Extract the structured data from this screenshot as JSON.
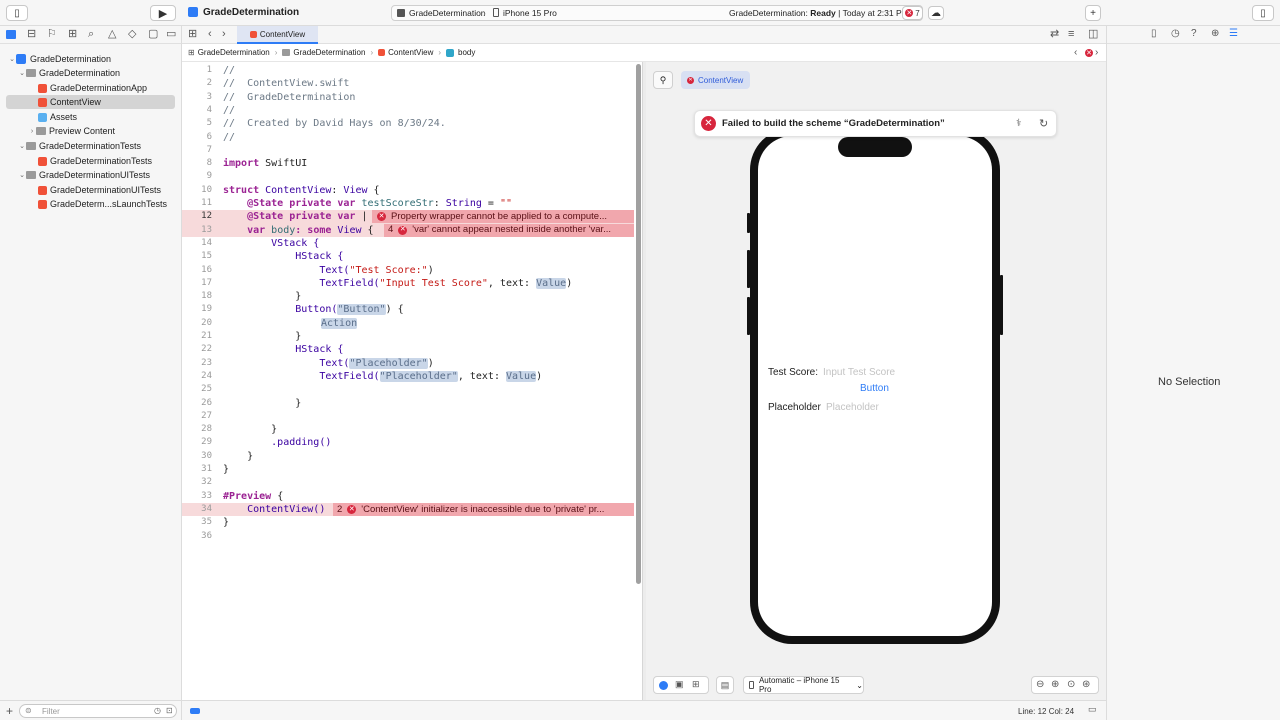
{
  "toolbar": {
    "project_name": "GradeDetermination",
    "scheme": "GradeDetermination",
    "device": "iPhone 15 Pro",
    "status_prefix": "GradeDetermination: ",
    "status_state": "Ready",
    "status_time": "| Today at 2:31 PM",
    "error_count": "7"
  },
  "tab": {
    "label": "ContentView"
  },
  "jumpbar": [
    "GradeDetermination",
    "GradeDetermination",
    "ContentView",
    "body"
  ],
  "navigator": {
    "items": [
      {
        "label": "GradeDetermination",
        "kind": "project"
      },
      {
        "label": "GradeDetermination",
        "kind": "folder"
      },
      {
        "label": "GradeDeterminationApp",
        "kind": "swift"
      },
      {
        "label": "ContentView",
        "kind": "swift"
      },
      {
        "label": "Assets",
        "kind": "asset"
      },
      {
        "label": "Preview Content",
        "kind": "folder"
      },
      {
        "label": "GradeDeterminationTests",
        "kind": "folder"
      },
      {
        "label": "GradeDeterminationTests",
        "kind": "swift"
      },
      {
        "label": "GradeDeterminationUITests",
        "kind": "folder"
      },
      {
        "label": "GradeDeterminationUITests",
        "kind": "swift"
      },
      {
        "label": "GradeDeterm...sLaunchTests",
        "kind": "swift"
      }
    ],
    "filter_placeholder": "Filter"
  },
  "code": {
    "line_numbers": [
      "1",
      "2",
      "3",
      "4",
      "5",
      "6",
      "7",
      "8",
      "9",
      "10",
      "11",
      "12",
      "13",
      "14",
      "15",
      "16",
      "17",
      "18",
      "19",
      "20",
      "21",
      "22",
      "23",
      "24",
      "25",
      "26",
      "27",
      "28",
      "29",
      "30",
      "31",
      "32",
      "33",
      "34",
      "35",
      "36"
    ],
    "l1": "//",
    "l2": "//  ContentView.swift",
    "l3": "//  GradeDetermination",
    "l4": "//",
    "l5": "//  Created by David Hays on 8/30/24.",
    "l6": "//",
    "l8a": "import",
    "l8b": " SwiftUI",
    "l10a": "struct",
    "l10b": " ContentView",
    "l10c": ": ",
    "l10d": "View",
    "l10e": " {",
    "l11a": "    @State private var ",
    "l11b": "testScoreStr",
    "l11c": ": ",
    "l11d": "String",
    "l11e": " = ",
    "l11f": "\"\"",
    "l12a": "    @State private var ",
    "l12b": "|",
    "l13a": "    var ",
    "l13b": "body",
    "l13c": ": some ",
    "l13d": "View",
    "l13e": " {",
    "l14": "        VStack {",
    "l15": "            HStack {",
    "l16a": "                Text(",
    "l16b": "\"Test Score:\"",
    "l16c": ")",
    "l17a": "                TextField(",
    "l17b": "\"Input Test Score\"",
    "l17c": ", text: ",
    "l17d": "Value",
    "l17e": ")",
    "l18": "            }",
    "l19a": "            Button(",
    "l19b": "\"Button\"",
    "l19c": ") {",
    "l20": "Action",
    "l21": "            }",
    "l22": "            HStack {",
    "l23a": "                Text(",
    "l23b": "\"Placeholder\"",
    "l23c": ")",
    "l24a": "                TextField(",
    "l24b": "\"Placeholder\"",
    "l24c": ", text: ",
    "l24d": "Value",
    "l24e": ")",
    "l26": "            }",
    "l28": "        }",
    "l29": "        .padding()",
    "l30": "    }",
    "l31": "}",
    "l33a": "#Preview",
    "l33b": " {",
    "l34": "    ContentView()",
    "l35": "}"
  },
  "errors": {
    "e12": "Property wrapper cannot be applied to a compute...",
    "e13_count": "4",
    "e13": "'var' cannot appear nested inside another 'var...",
    "e34_count": "2",
    "e34": "'ContentView' initializer is inaccessible due to 'private' pr..."
  },
  "preview": {
    "tab_label": "ContentView",
    "build_error": "Failed to build the scheme “GradeDetermination”",
    "test_score_label": "Test Score:",
    "test_score_placeholder": "Input Test Score",
    "button_label": "Button",
    "placeholder_label": "Placeholder",
    "placeholder_field": "Placeholder",
    "device_menu": "Automatic – iPhone 15 Pro"
  },
  "inspector": {
    "empty_text": "No Selection"
  },
  "status": {
    "cursor": "Line: 12  Col: 24"
  },
  "colors": {
    "error": "#d7263d",
    "accent": "#2e7cf6",
    "error_line": "#f7dadb",
    "error_banner": "#f1a7ad"
  }
}
